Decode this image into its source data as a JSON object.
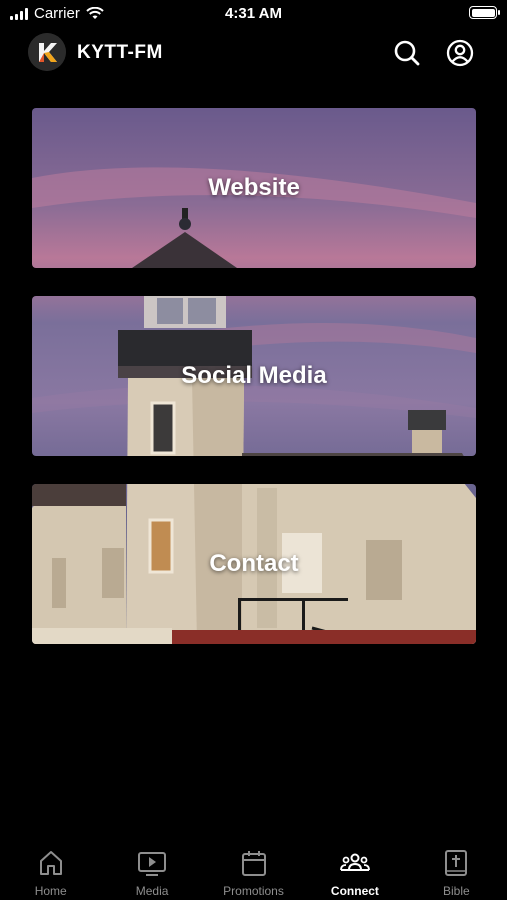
{
  "status_bar": {
    "carrier": "Carrier",
    "time": "4:31 AM"
  },
  "header": {
    "title": "KYTT-FM",
    "logo_letter": "K"
  },
  "cards": [
    {
      "label": "Website"
    },
    {
      "label": "Social Media"
    },
    {
      "label": "Contact"
    }
  ],
  "tabs": [
    {
      "label": "Home",
      "icon": "home-icon"
    },
    {
      "label": "Media",
      "icon": "tv-play-icon"
    },
    {
      "label": "Promotions",
      "icon": "calendar-icon"
    },
    {
      "label": "Connect",
      "icon": "people-icon",
      "active": true
    },
    {
      "label": "Bible",
      "icon": "bible-icon"
    }
  ],
  "colors": {
    "background": "#000000",
    "active_tab": "#ffffff",
    "inactive_tab": "#8e8e8e"
  }
}
